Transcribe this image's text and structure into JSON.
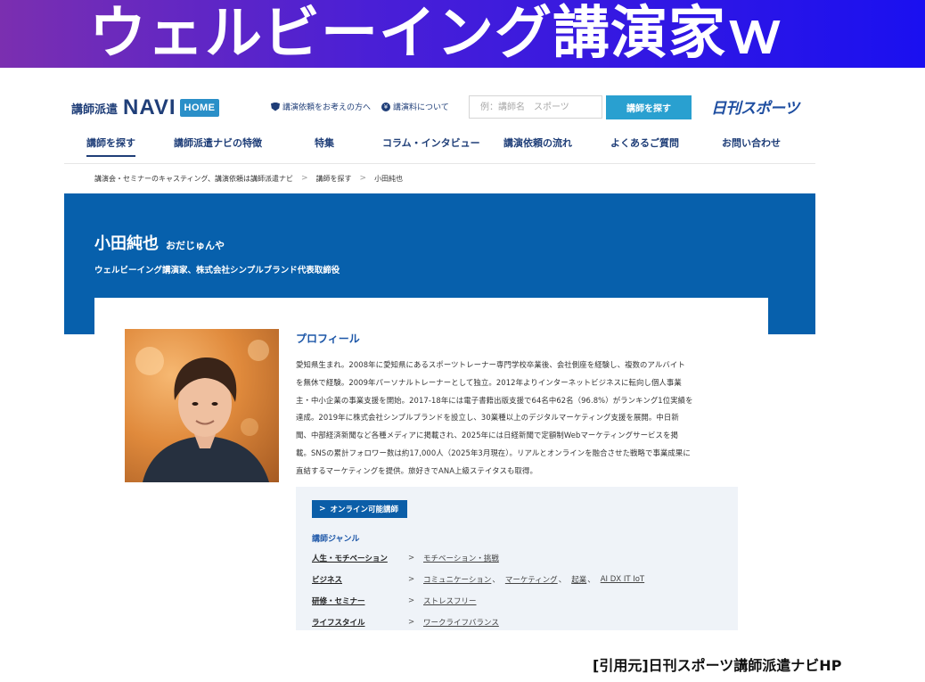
{
  "slide": {
    "title": "ウェルビーイング講演家ｗ",
    "citation": "[引用元]日刊スポーツ講師派遣ナビHP",
    "banner_gradient": [
      "#7b2fb0",
      "#1a10f0"
    ]
  },
  "header": {
    "logo_small": "講師派遣",
    "logo_navi": "NAVI",
    "home_label": "HOME",
    "util_links": [
      "講演依頼をお考えの方へ",
      "講演料について"
    ],
    "search_placeholder": "例：講師名　スポーツ",
    "search_button": "講師を探す",
    "brand": "日刊スポーツ"
  },
  "nav": {
    "items": [
      "講師を探す",
      "講師派遣ナビの特徴",
      "特集",
      "コラム・インタビュー",
      "講演依頼の流れ",
      "よくあるご質問",
      "お問い合わせ"
    ],
    "active_index": 0
  },
  "breadcrumb": [
    "講演会・セミナーのキャスティング、講演依頼は講師派遣ナビ",
    "講師を探す",
    "小田純也"
  ],
  "hero": {
    "name": "小田純也",
    "kana": "おだじゅんや",
    "title": "ウェルビーイング講演家、株式会社シンプルブランド代表取締役",
    "color": "#0760ac"
  },
  "profile": {
    "heading": "プロフィール",
    "lines": [
      "愛知県生まれ。2008年に愛知県にあるスポーツトレーナー専門学校卒業後、会社側座を経験し、複数のアルバイト",
      "を無休で経験。2009年パーソナルトレーナーとして独立。2012年よりインターネットビジネスに転向し個人事業",
      "主・中小企業の事業支援を開始。2017-18年には電子書籍出版支援で64名中62名（96.8%）がランキング1位実績を",
      "達成。2019年に株式会社シンプルブランドを設立し、30業種以上のデジタルマーケティング支援を展開。中日新",
      "聞、中部経済新聞など各種メディアに掲載され、2025年には日経新聞で定額制Webマーケティングサービスを掲",
      "載。SNSの累計フォロワー数は約17,000人（2025年3月現在）。リアルとオンラインを融合させた戦略で事業成果に",
      "直結するマーケティングを提供。旅好きでANA上級ステイタスも取得。"
    ]
  },
  "genres": {
    "online_badge": "オンライン可能講師",
    "heading": "講師ジャンル",
    "rows": [
      {
        "name": "人生・モチベーション",
        "tags": [
          "モチベーション・挑戦"
        ]
      },
      {
        "name": "ビジネス",
        "tags": [
          "コミュニケーション",
          "マーケティング",
          "起業",
          "AI DX IT IoT"
        ]
      },
      {
        "name": "研修・セミナー",
        "tags": [
          "ストレスフリー"
        ]
      },
      {
        "name": "ライフスタイル",
        "tags": [
          "ワークライフバランス"
        ]
      }
    ]
  }
}
